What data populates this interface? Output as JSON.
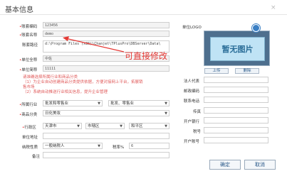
{
  "dialog": {
    "title": "基本信息",
    "close_icon": "×"
  },
  "fields": {
    "account_code": {
      "label": "账套编码",
      "value": "123456"
    },
    "account_name": {
      "label": "账套名称",
      "value": "demo"
    },
    "account_path": {
      "label": "账套路径",
      "value": "d:\\Program Files (x86)\\Chanjet\\TPlusPro\\DBServer\\Data\\"
    },
    "unit_full_name": {
      "label": "单位全称",
      "value": "中佐"
    },
    "unit_abbr": {
      "label": "单位简称",
      "value": "11111"
    },
    "industry": {
      "label": "所属行业",
      "value1": "批发和零售业",
      "value2": "批发、零售业"
    },
    "product_category": {
      "label": "商品分类",
      "value": "日化美妆"
    },
    "region": {
      "label": "行政区",
      "province": "天津市",
      "city": "市辖区",
      "district": "和平区"
    },
    "unit_address": {
      "label": "单位地址",
      "value": ""
    },
    "taxpayer": {
      "label": "纳税性质",
      "value": "一般纳税人",
      "tax_rate_label": "税率%",
      "tax_rate": "6"
    },
    "remark": {
      "label": "备注",
      "value": ""
    }
  },
  "notice": {
    "line1": "请准确选择所属行业和商品分类",
    "line2": "（1）为企业自动创建商品分类提供依据，方便对接网上平台，拓展销",
    "line3": "售市场",
    "line4": "（2）系统自动推送行业相关信息，提升企业管理"
  },
  "annotation": "可直接修改",
  "logo": {
    "label": "单位LOGO",
    "placeholder": "暂无图片",
    "upload": "上传",
    "delete": "删除"
  },
  "right_fields": {
    "legal_rep": "法人代表",
    "postcode": "邮政编码",
    "phone": "联系电话",
    "fax": "传真",
    "bank": "开户银行",
    "tax_no": "税号",
    "account_no": "开户账号"
  },
  "buttons": {
    "ok": "确定",
    "cancel": "取消"
  },
  "colors": {
    "required": "#e33333",
    "annotation": "#e53935",
    "logo_bg": "#4e6f8e"
  }
}
